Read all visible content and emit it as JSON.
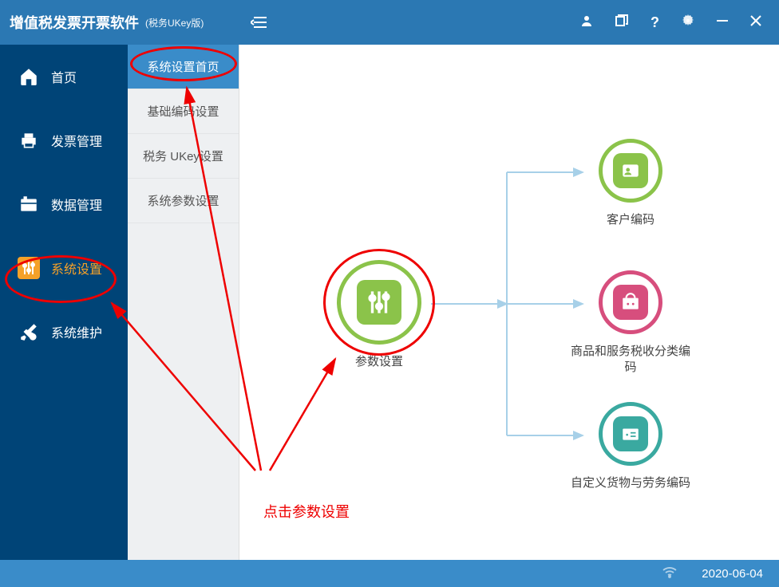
{
  "titlebar": {
    "title": "增值税发票开票软件",
    "version": "(税务UKey版)"
  },
  "sidebar": {
    "items": [
      {
        "label": "首页"
      },
      {
        "label": "发票管理"
      },
      {
        "label": "数据管理"
      },
      {
        "label": "系统设置"
      },
      {
        "label": "系统维护"
      }
    ]
  },
  "submenu": {
    "items": [
      {
        "label": "系统设置首页"
      },
      {
        "label": "基础编码设置"
      },
      {
        "label": "税务 UKey设置"
      },
      {
        "label": "系统参数设置"
      }
    ]
  },
  "nodes": {
    "main": "参数设置",
    "r1": "客户编码",
    "r2": "商品和服务税收分类编码",
    "r3": "自定义货物与劳务编码"
  },
  "annotation": {
    "text": "点击参数设置"
  },
  "statusbar": {
    "date": "2020-06-04"
  }
}
